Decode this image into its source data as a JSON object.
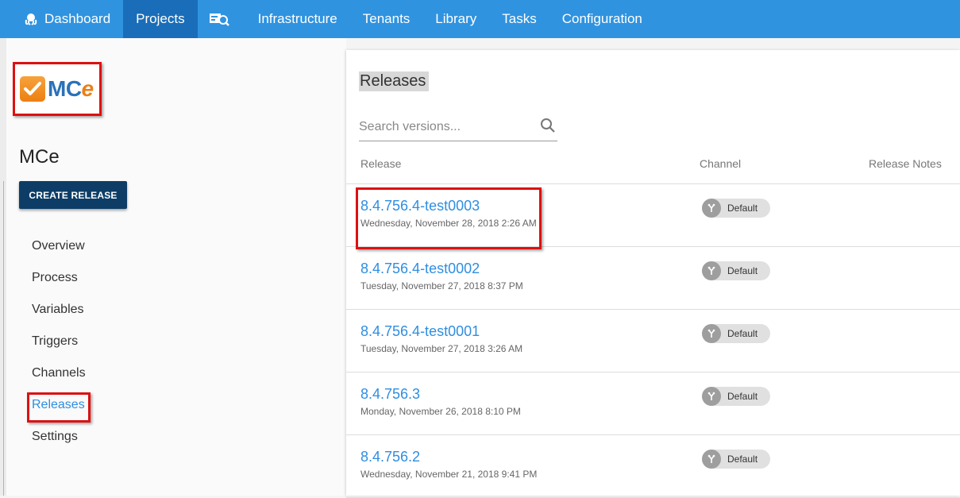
{
  "nav": {
    "items": [
      {
        "label": "Dashboard",
        "icon": "octopus-icon"
      },
      {
        "label": "Projects"
      },
      {
        "label": "",
        "icon": "search-machines-icon"
      },
      {
        "label": "Infrastructure"
      },
      {
        "label": "Tenants"
      },
      {
        "label": "Library"
      },
      {
        "label": "Tasks"
      },
      {
        "label": "Configuration"
      }
    ],
    "active": "Projects",
    "color": "#2f93e0",
    "active_color": "#1a6db8"
  },
  "sidebar": {
    "logo": {
      "text_main": "MC",
      "text_accent": "e"
    },
    "project_name": "MCe",
    "create_button": "CREATE RELEASE",
    "menu": [
      "Overview",
      "Process",
      "Variables",
      "Triggers",
      "Channels",
      "Releases",
      "Settings"
    ],
    "active_item": "Releases"
  },
  "main": {
    "title": "Releases",
    "search_placeholder": "Search versions...",
    "columns": {
      "release": "Release",
      "channel": "Channel",
      "notes": "Release Notes"
    },
    "releases": [
      {
        "version": "8.4.756.4-test0003",
        "date": "Wednesday, November 28, 2018 2:26 AM",
        "channel": "Default"
      },
      {
        "version": "8.4.756.4-test0002",
        "date": "Tuesday, November 27, 2018 8:37 PM",
        "channel": "Default"
      },
      {
        "version": "8.4.756.4-test0001",
        "date": "Tuesday, November 27, 2018 3:26 AM",
        "channel": "Default"
      },
      {
        "version": "8.4.756.3",
        "date": "Monday, November 26, 2018 8:10 PM",
        "channel": "Default"
      },
      {
        "version": "8.4.756.2",
        "date": "Wednesday, November 21, 2018 9:41 PM",
        "channel": "Default"
      }
    ],
    "link_color": "#2f8ee0"
  },
  "annotations": {
    "highlight_color": "#dd1111"
  }
}
